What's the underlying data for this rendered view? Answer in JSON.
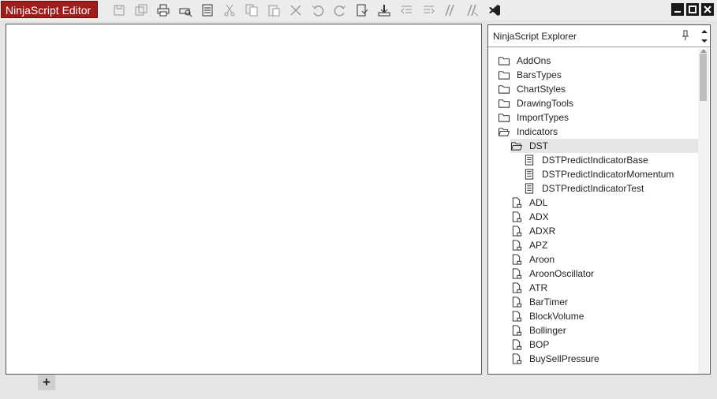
{
  "window": {
    "title": "NinjaScript Editor"
  },
  "toolbar": {
    "buttons": [
      {
        "name": "save-icon"
      },
      {
        "name": "save-all-icon"
      },
      {
        "name": "print-icon"
      },
      {
        "name": "print-preview-icon"
      },
      {
        "name": "page-setup-icon"
      },
      {
        "name": "cut-icon"
      },
      {
        "name": "copy-icon"
      },
      {
        "name": "paste-icon"
      },
      {
        "name": "delete-icon"
      },
      {
        "name": "undo-icon"
      },
      {
        "name": "redo-icon"
      },
      {
        "name": "compile-icon"
      },
      {
        "name": "import-icon"
      },
      {
        "name": "outdent-icon"
      },
      {
        "name": "indent-icon"
      },
      {
        "name": "comment-icon"
      },
      {
        "name": "uncomment-icon"
      },
      {
        "name": "visual-studio-icon"
      }
    ]
  },
  "explorer": {
    "title": "NinjaScript Explorer",
    "items": [
      {
        "label": "AddOns",
        "kind": "folder",
        "level": 0
      },
      {
        "label": "BarsTypes",
        "kind": "folder",
        "level": 0
      },
      {
        "label": "ChartStyles",
        "kind": "folder",
        "level": 0
      },
      {
        "label": "DrawingTools",
        "kind": "folder",
        "level": 0
      },
      {
        "label": "ImportTypes",
        "kind": "folder",
        "level": 0
      },
      {
        "label": "Indicators",
        "kind": "folder-open",
        "level": 0
      },
      {
        "label": "DST",
        "kind": "folder-open",
        "level": 1,
        "selected": true
      },
      {
        "label": "DSTPredictIndicatorBase",
        "kind": "file",
        "level": 2
      },
      {
        "label": "DSTPredictIndicatorMomentum",
        "kind": "file",
        "level": 2
      },
      {
        "label": "DSTPredictIndicatorTest",
        "kind": "file",
        "level": 2
      },
      {
        "label": "ADL",
        "kind": "locked-file",
        "level": 1
      },
      {
        "label": "ADX",
        "kind": "locked-file",
        "level": 1
      },
      {
        "label": "ADXR",
        "kind": "locked-file",
        "level": 1
      },
      {
        "label": "APZ",
        "kind": "locked-file",
        "level": 1
      },
      {
        "label": "Aroon",
        "kind": "locked-file",
        "level": 1
      },
      {
        "label": "AroonOscillator",
        "kind": "locked-file",
        "level": 1
      },
      {
        "label": "ATR",
        "kind": "locked-file",
        "level": 1
      },
      {
        "label": "BarTimer",
        "kind": "locked-file",
        "level": 1
      },
      {
        "label": "BlockVolume",
        "kind": "locked-file",
        "level": 1
      },
      {
        "label": "Bollinger",
        "kind": "locked-file",
        "level": 1
      },
      {
        "label": "BOP",
        "kind": "locked-file",
        "level": 1
      },
      {
        "label": "BuySellPressure",
        "kind": "locked-file",
        "level": 1
      }
    ]
  },
  "footer": {
    "add_tab_label": "+"
  }
}
